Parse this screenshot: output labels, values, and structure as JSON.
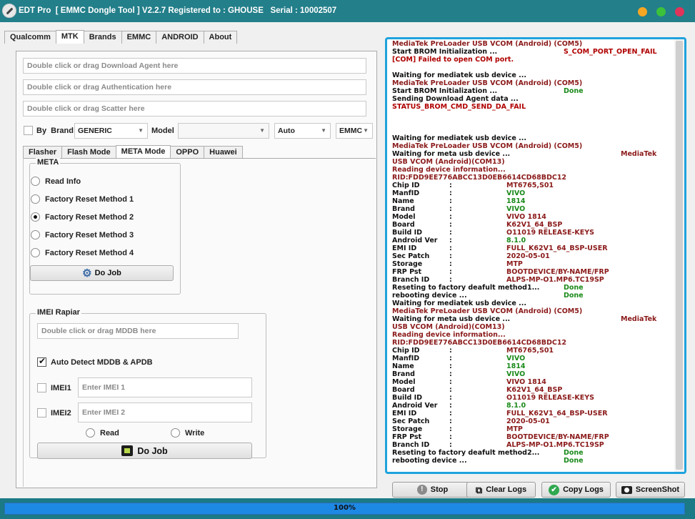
{
  "window": {
    "title": "EDT Pro  [ EMMC Dongle Tool ] V2.2.7 Registered to : GHOUSE   Serial : 10002507",
    "controls": {
      "minimize_color": "#f5a623",
      "maximize_color": "#3cc13b",
      "close_color": "#e0345a"
    }
  },
  "colors": {
    "accent": "#237f8a",
    "log_border": "#1ea3dc",
    "progress": "#1e88e5",
    "log_red": "#b00000",
    "log_green": "#1a8a1a"
  },
  "main_tabs": [
    {
      "label": "Qualcomm",
      "active": false
    },
    {
      "label": "MTK",
      "active": true
    },
    {
      "label": "Brands",
      "active": false
    },
    {
      "label": "EMMC",
      "active": false
    },
    {
      "label": "ANDROID",
      "active": false
    },
    {
      "label": "About",
      "active": false
    }
  ],
  "mtk": {
    "download_agent_placeholder": "Double click or drag Download Agent  here",
    "authentication_placeholder": "Double click or drag Authentication  here",
    "scatter_placeholder": "Double click or drag Scatter  here",
    "by_brand_label": "By  Brand",
    "by_brand_checked": false,
    "brand_value": "GENERIC",
    "model_label": "Model",
    "model_value": "",
    "connection_value": "Auto",
    "storage_value": "EMMC"
  },
  "sub_tabs": [
    {
      "label": "Flasher",
      "active": false
    },
    {
      "label": "Flash Mode",
      "active": false
    },
    {
      "label": "META Mode",
      "active": true
    },
    {
      "label": "OPPO",
      "active": false
    },
    {
      "label": "Huawei",
      "active": false
    }
  ],
  "meta": {
    "group_title": "META",
    "options": [
      {
        "label": "Read Info",
        "selected": false
      },
      {
        "label": "Factory Reset Method 1",
        "selected": false
      },
      {
        "label": "Factory Reset Method 2",
        "selected": true
      },
      {
        "label": "Factory Reset Method 3",
        "selected": false
      },
      {
        "label": "Factory Reset Method 4",
        "selected": false
      }
    ],
    "do_job_label": "Do Job"
  },
  "imei": {
    "group_title": "IMEI Rapiar",
    "mddb_placeholder": "Double click or drag MDDB  here",
    "auto_detect_label": "Auto Detect MDDB & APDB",
    "auto_detect_checked": true,
    "imei1_label": "IMEI1",
    "imei1_placeholder": "Enter IMEI 1",
    "imei2_label": "IMEI2",
    "imei2_placeholder": "Enter IMEI 2",
    "read_label": "Read",
    "write_label": "Write",
    "do_job_label": "Do Job"
  },
  "log": [
    {
      "a": "MediaTek PreLoader USB VCOM (Android) (COM5)",
      "ac": "m"
    },
    {
      "a": "Start BROM Initialization ...",
      "ac": "b",
      "b": "S_COM_PORT_OPEN_FAIL",
      "bc": "r"
    },
    {
      "a": "[COM] Failed to open COM port.",
      "ac": "r"
    },
    {
      "a": ""
    },
    {
      "a": "Waiting for mediatek usb device ...",
      "ac": "b"
    },
    {
      "a": "MediaTek PreLoader USB VCOM (Android) (COM5)",
      "ac": "m"
    },
    {
      "a": "Start BROM Initialization ...",
      "ac": "b",
      "b": "Done",
      "bc": "g"
    },
    {
      "a": "Sending Download Agent data ...",
      "ac": "b"
    },
    {
      "a": "STATUS_BROM_CMD_SEND_DA_FAIL",
      "ac": "r"
    },
    {
      "a": ""
    },
    {
      "a": ""
    },
    {
      "a": ""
    },
    {
      "a": "Waiting for mediatek usb device ...",
      "ac": "b"
    },
    {
      "a": "MediaTek PreLoader USB VCOM (Android) (COM5)",
      "ac": "m"
    },
    {
      "a": "Waiting for meta usb device ...",
      "ac": "b",
      "c": "MediaTek",
      "cc": "m"
    },
    {
      "a": "USB VCOM (Android)(COM13)",
      "ac": "m"
    },
    {
      "a": "Reading device information...",
      "ac": "m"
    },
    {
      "a": "RID:FDD9EE776ABCC13D0EB6614CD68BDC12",
      "ac": "m"
    },
    {
      "a": "Chip ID",
      "ac": "b",
      "s": ":",
      "v": "MT6765,S01",
      "vc": "m"
    },
    {
      "a": "ManfID",
      "ac": "b",
      "s": ":",
      "v": "VIVO",
      "vc": "g"
    },
    {
      "a": "Name",
      "ac": "b",
      "s": ":",
      "v": "1814",
      "vc": "g"
    },
    {
      "a": "Brand",
      "ac": "b",
      "s": ":",
      "v": "VIVO",
      "vc": "g"
    },
    {
      "a": "Model",
      "ac": "b",
      "s": ":",
      "v": "VIVO 1814",
      "vc": "m"
    },
    {
      "a": "Board",
      "ac": "b",
      "s": ":",
      "v": "K62V1_64_BSP",
      "vc": "m"
    },
    {
      "a": "Build ID",
      "ac": "b",
      "s": ":",
      "v": "O11019 RELEASE-KEYS",
      "vc": "m"
    },
    {
      "a": "Android Ver",
      "ac": "b",
      "s": ":",
      "v": "8.1.0",
      "vc": "g"
    },
    {
      "a": "EMI ID",
      "ac": "b",
      "s": ":",
      "v": "FULL_K62V1_64_BSP-USER",
      "vc": "m"
    },
    {
      "a": "Sec Patch",
      "ac": "b",
      "s": ":",
      "v": "2020-05-01",
      "vc": "m"
    },
    {
      "a": "Storage",
      "ac": "b",
      "s": ":",
      "v": "MTP",
      "vc": "m"
    },
    {
      "a": "FRP Pst",
      "ac": "b",
      "s": ":",
      "v": "BOOTDEVICE/BY-NAME/FRP",
      "vc": "m"
    },
    {
      "a": "Branch ID",
      "ac": "b",
      "s": ":",
      "v": "ALPS-MP-O1.MP6.TC19SP",
      "vc": "m"
    },
    {
      "a": "Reseting to factory deafult method1...",
      "ac": "b",
      "b": "Done",
      "bc": "g"
    },
    {
      "a": "rebooting device ...",
      "ac": "b",
      "b": "Done",
      "bc": "g"
    },
    {
      "a": "Waiting for mediatek usb device ...",
      "ac": "b"
    },
    {
      "a": "MediaTek PreLoader USB VCOM (Android) (COM5)",
      "ac": "m"
    },
    {
      "a": "Waiting for meta usb device ...",
      "ac": "b",
      "c": "MediaTek",
      "cc": "m"
    },
    {
      "a": "USB VCOM (Android)(COM13)",
      "ac": "m"
    },
    {
      "a": "Reading device information...",
      "ac": "m"
    },
    {
      "a": "RID:FDD9EE776ABCC13D0EB6614CD68BDC12",
      "ac": "m"
    },
    {
      "a": "Chip ID",
      "ac": "b",
      "s": ":",
      "v": "MT6765,S01",
      "vc": "m"
    },
    {
      "a": "ManfID",
      "ac": "b",
      "s": ":",
      "v": "VIVO",
      "vc": "g"
    },
    {
      "a": "Name",
      "ac": "b",
      "s": ":",
      "v": "1814",
      "vc": "g"
    },
    {
      "a": "Brand",
      "ac": "b",
      "s": ":",
      "v": "VIVO",
      "vc": "g"
    },
    {
      "a": "Model",
      "ac": "b",
      "s": ":",
      "v": "VIVO 1814",
      "vc": "m"
    },
    {
      "a": "Board",
      "ac": "b",
      "s": ":",
      "v": "K62V1_64_BSP",
      "vc": "m"
    },
    {
      "a": "Build ID",
      "ac": "b",
      "s": ":",
      "v": "O11019 RELEASE-KEYS",
      "vc": "m"
    },
    {
      "a": "Android Ver",
      "ac": "b",
      "s": ":",
      "v": "8.1.0",
      "vc": "g"
    },
    {
      "a": "EMI ID",
      "ac": "b",
      "s": ":",
      "v": "FULL_K62V1_64_BSP-USER",
      "vc": "m"
    },
    {
      "a": "Sec Patch",
      "ac": "b",
      "s": ":",
      "v": "2020-05-01",
      "vc": "m"
    },
    {
      "a": "Storage",
      "ac": "b",
      "s": ":",
      "v": "MTP",
      "vc": "m"
    },
    {
      "a": "FRP Pst",
      "ac": "b",
      "s": ":",
      "v": "BOOTDEVICE/BY-NAME/FRP",
      "vc": "m"
    },
    {
      "a": "Branch ID",
      "ac": "b",
      "s": ":",
      "v": "ALPS-MP-O1.MP6.TC19SP",
      "vc": "m"
    },
    {
      "a": "Reseting to factory deafult method2...",
      "ac": "b",
      "b": "Done",
      "bc": "g"
    },
    {
      "a": "rebooting device ...",
      "ac": "b",
      "b": "Done",
      "bc": "g"
    }
  ],
  "actions": {
    "stop_label": "Stop",
    "clear_logs_label": "Clear Logs",
    "copy_logs_label": "Copy Logs",
    "screenshot_label": "ScreenShot"
  },
  "progress": {
    "value": 1.0,
    "label": "100%"
  }
}
